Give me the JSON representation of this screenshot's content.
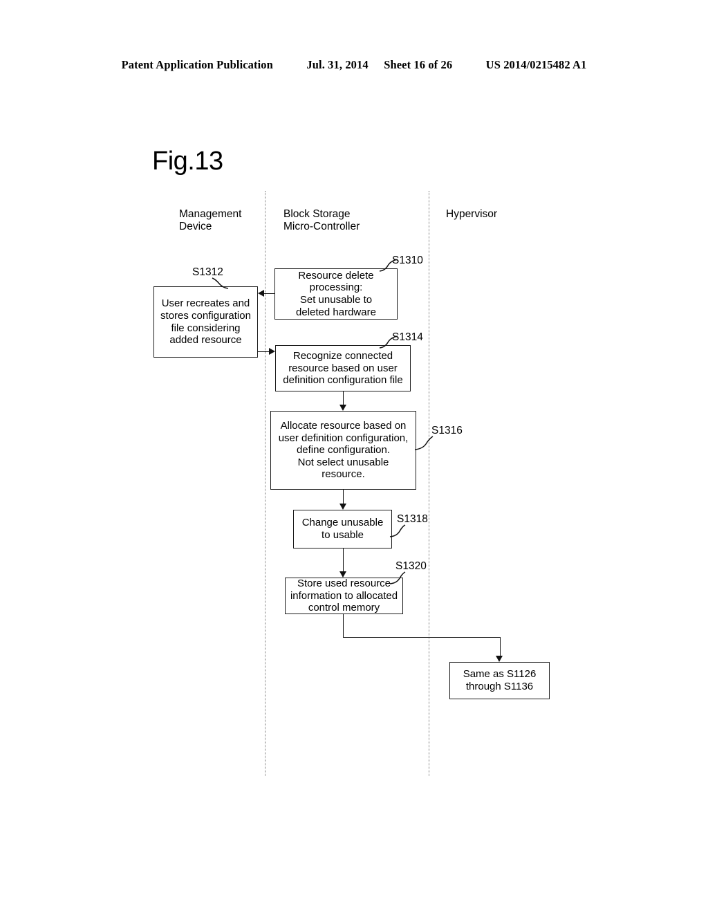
{
  "header": {
    "publication": "Patent Application Publication",
    "date": "Jul. 31, 2014",
    "sheet": "Sheet 16 of 26",
    "number": "US 2014/0215482 A1"
  },
  "figure": {
    "title": "Fig.13"
  },
  "lanes": [
    {
      "id": "management-device",
      "label": "Management\nDevice"
    },
    {
      "id": "block-storage-micro-controller",
      "label": "Block Storage\nMicro-Controller"
    },
    {
      "id": "hypervisor",
      "label": "Hypervisor"
    }
  ],
  "steps": [
    {
      "id": "s1310",
      "number": "S1310",
      "lane": "block-storage-micro-controller",
      "text": "Resource delete\nprocessing:\nSet unusable to\ndeleted hardware"
    },
    {
      "id": "s1312",
      "number": "S1312",
      "lane": "management-device",
      "text": "User recreates and\nstores configuration\nfile considering\nadded resource"
    },
    {
      "id": "s1314",
      "number": "S1314",
      "lane": "block-storage-micro-controller",
      "text": "Recognize connected\nresource based on user\ndefinition configuration file"
    },
    {
      "id": "s1316",
      "number": "S1316",
      "lane": "block-storage-micro-controller",
      "text": "Allocate resource based on\nuser definition configuration,\ndefine configuration.\nNot select unusable\nresource."
    },
    {
      "id": "s1318",
      "number": "S1318",
      "lane": "block-storage-micro-controller",
      "text": "Change unusable\nto usable"
    },
    {
      "id": "s1320",
      "number": "S1320",
      "lane": "block-storage-micro-controller",
      "text": "Store used resource\ninformation to allocated\ncontrol memory"
    },
    {
      "id": "same-as",
      "number": "",
      "lane": "hypervisor",
      "text": "Same as S1126\nthrough S1136"
    }
  ],
  "colors": {
    "ink": "#000000",
    "line": "#111111",
    "divider": "#7d7d7d",
    "background": "#ffffff"
  }
}
